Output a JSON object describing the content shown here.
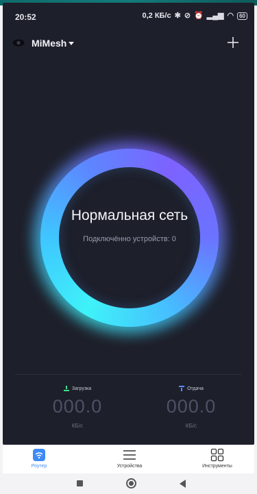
{
  "status_bar": {
    "time": "20:52",
    "network_speed": "0,2 КБ/с",
    "battery": "60",
    "icons": [
      "bluetooth-icon",
      "dnd-icon",
      "alarm-icon",
      "signal-icon",
      "wifi-icon",
      "battery-icon"
    ]
  },
  "header": {
    "network_name": "MiMesh",
    "icons": [
      "eye-icon",
      "caret-down-icon",
      "add-icon"
    ]
  },
  "status_ring": {
    "title": "Нормальная сеть",
    "subtitle": "Подключённо устройств: 0",
    "colors": {
      "cyan": "#3ff2f8",
      "blue": "#5d86ff",
      "violet": "#7d62ff"
    }
  },
  "stats": {
    "download": {
      "label": "Загрузка",
      "value": "000.0",
      "unit": "КБ/с",
      "icon_color": "#3fe08a"
    },
    "upload": {
      "label": "Отдача",
      "value": "000.0",
      "unit": "КБ/с",
      "icon_color": "#5b8cff"
    }
  },
  "tabs": [
    {
      "label": "Роутер",
      "icon": "router-wifi-icon",
      "active": true
    },
    {
      "label": "Устройства",
      "icon": "list-icon",
      "active": false
    },
    {
      "label": "Инструменты",
      "icon": "grid-icon",
      "active": false
    }
  ],
  "accent": "#3d8af7",
  "background": "#1d1f2a"
}
